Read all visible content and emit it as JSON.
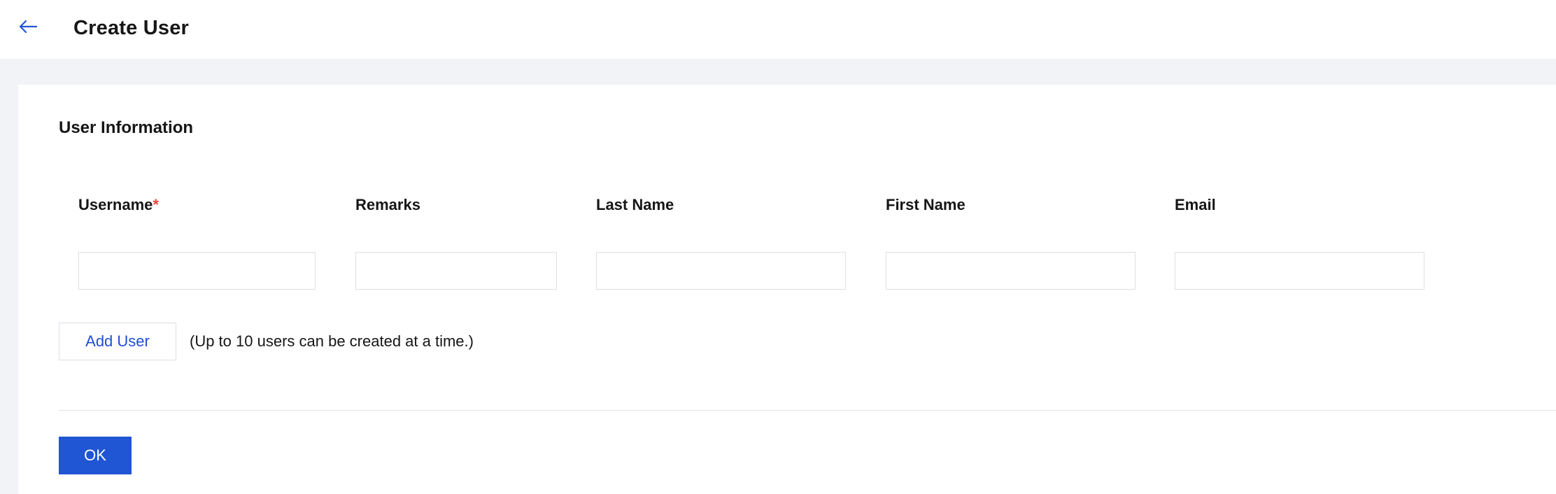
{
  "header": {
    "back_icon": "arrow-left-icon",
    "title": "Create User"
  },
  "form": {
    "section_title": "User Information",
    "columns": [
      {
        "label": "Username",
        "required": true,
        "value": ""
      },
      {
        "label": "Remarks",
        "required": false,
        "value": ""
      },
      {
        "label": "Last Name",
        "required": false,
        "value": ""
      },
      {
        "label": "First Name",
        "required": false,
        "value": ""
      },
      {
        "label": "Email",
        "required": false,
        "value": ""
      }
    ],
    "required_marker": "*",
    "add_user_label": "Add User",
    "hint": "(Up to 10 users can be created at a time.)",
    "ok_label": "OK"
  },
  "colors": {
    "accent": "#2055d4",
    "link": "#1f4fd1",
    "required": "#e54545",
    "page_background": "#f2f3f7"
  }
}
